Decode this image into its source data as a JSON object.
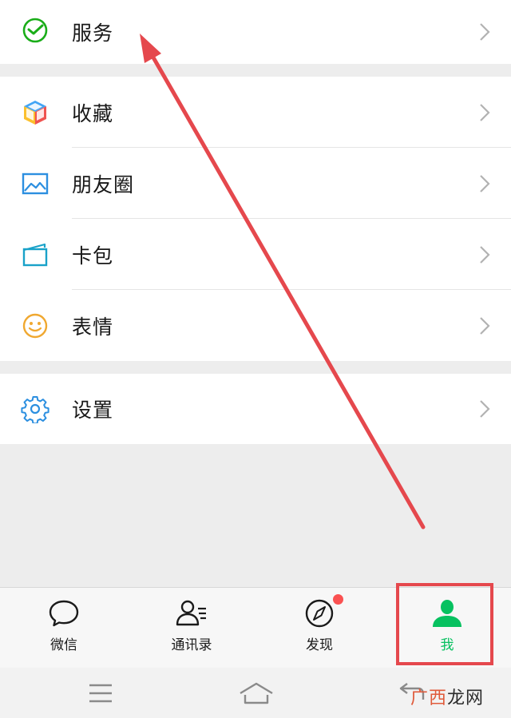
{
  "menu": {
    "services": {
      "label": "服务",
      "icon": "wechat-pay-icon"
    },
    "favorites": {
      "label": "收藏",
      "icon": "favorites-cube-icon"
    },
    "moments": {
      "label": "朋友圈",
      "icon": "moments-photo-icon"
    },
    "cards": {
      "label": "卡包",
      "icon": "card-wallet-icon"
    },
    "stickers": {
      "label": "表情",
      "icon": "smiley-icon"
    },
    "settings": {
      "label": "设置",
      "icon": "gear-icon"
    }
  },
  "tabs": [
    {
      "label": "微信",
      "icon": "chat-bubble-icon",
      "active": false
    },
    {
      "label": "通讯录",
      "icon": "contacts-icon",
      "active": false
    },
    {
      "label": "发现",
      "icon": "compass-icon",
      "active": false,
      "badge_dot": true
    },
    {
      "label": "我",
      "icon": "person-icon",
      "active": true
    }
  ],
  "navbar": [
    "menu-icon",
    "home-icon",
    "back-icon"
  ],
  "watermark": {
    "accent": "广西",
    "rest": "龙网"
  },
  "colors": {
    "accent_green": "#07c160",
    "annotation_red": "#e5484d",
    "badge_red": "#fa5151",
    "background": "#ededed"
  }
}
